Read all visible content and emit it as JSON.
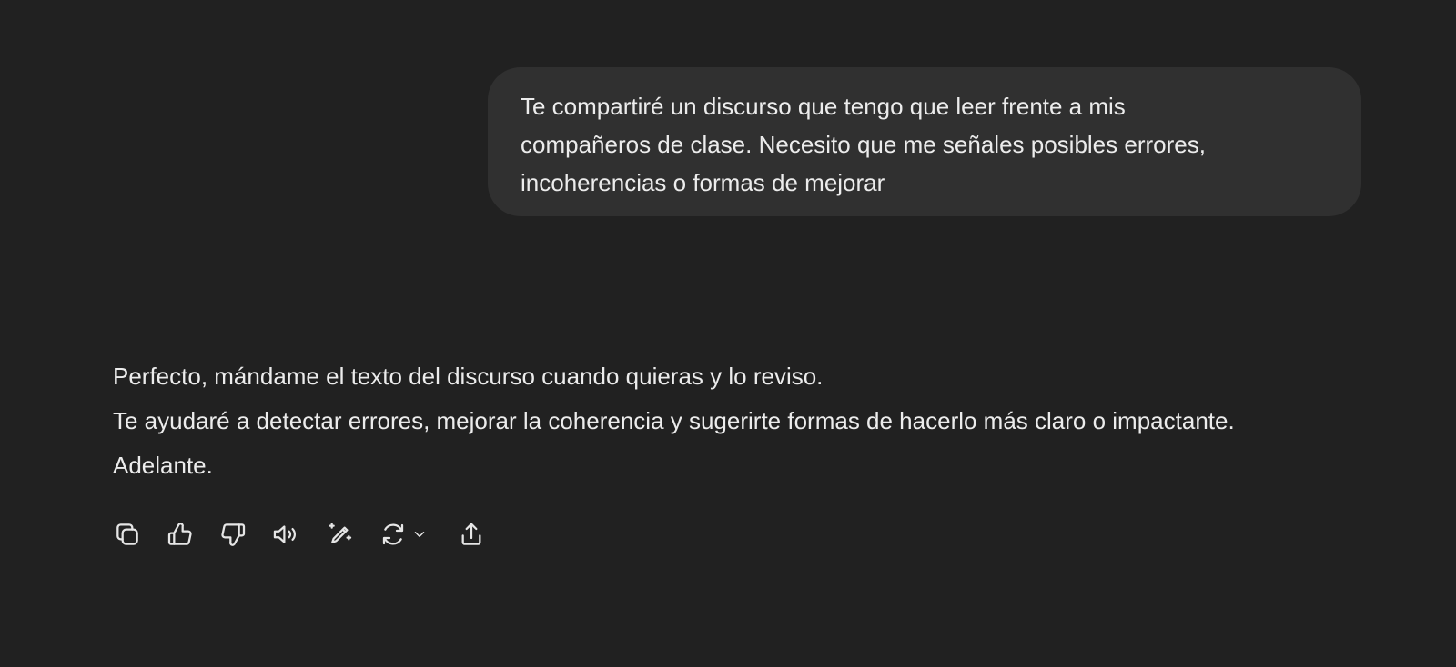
{
  "conversation": {
    "user_message": {
      "lines": [
        "Te compartiré un discurso que tengo que leer frente a mis",
        "compañeros de clase. Necesito que me señales posibles errores,",
        "incoherencias o formas de mejorar"
      ]
    },
    "assistant_message": {
      "lines": [
        "Perfecto, mándame el texto del discurso cuando quieras y lo reviso.",
        "Te ayudaré a detectar errores, mejorar la coherencia y sugerirte formas de hacerlo más claro o impactante.",
        "Adelante."
      ]
    }
  },
  "action_bar": {
    "icons": [
      "copy-icon",
      "thumbs-up-icon",
      "thumbs-down-icon",
      "read-aloud-icon",
      "edit-sparkle-icon",
      "regenerate-icon",
      "chevron-down-icon",
      "share-icon"
    ]
  },
  "colors": {
    "background": "#212121",
    "user_bubble": "#303030",
    "text": "#ececec",
    "icon": "#e6e6e6"
  }
}
